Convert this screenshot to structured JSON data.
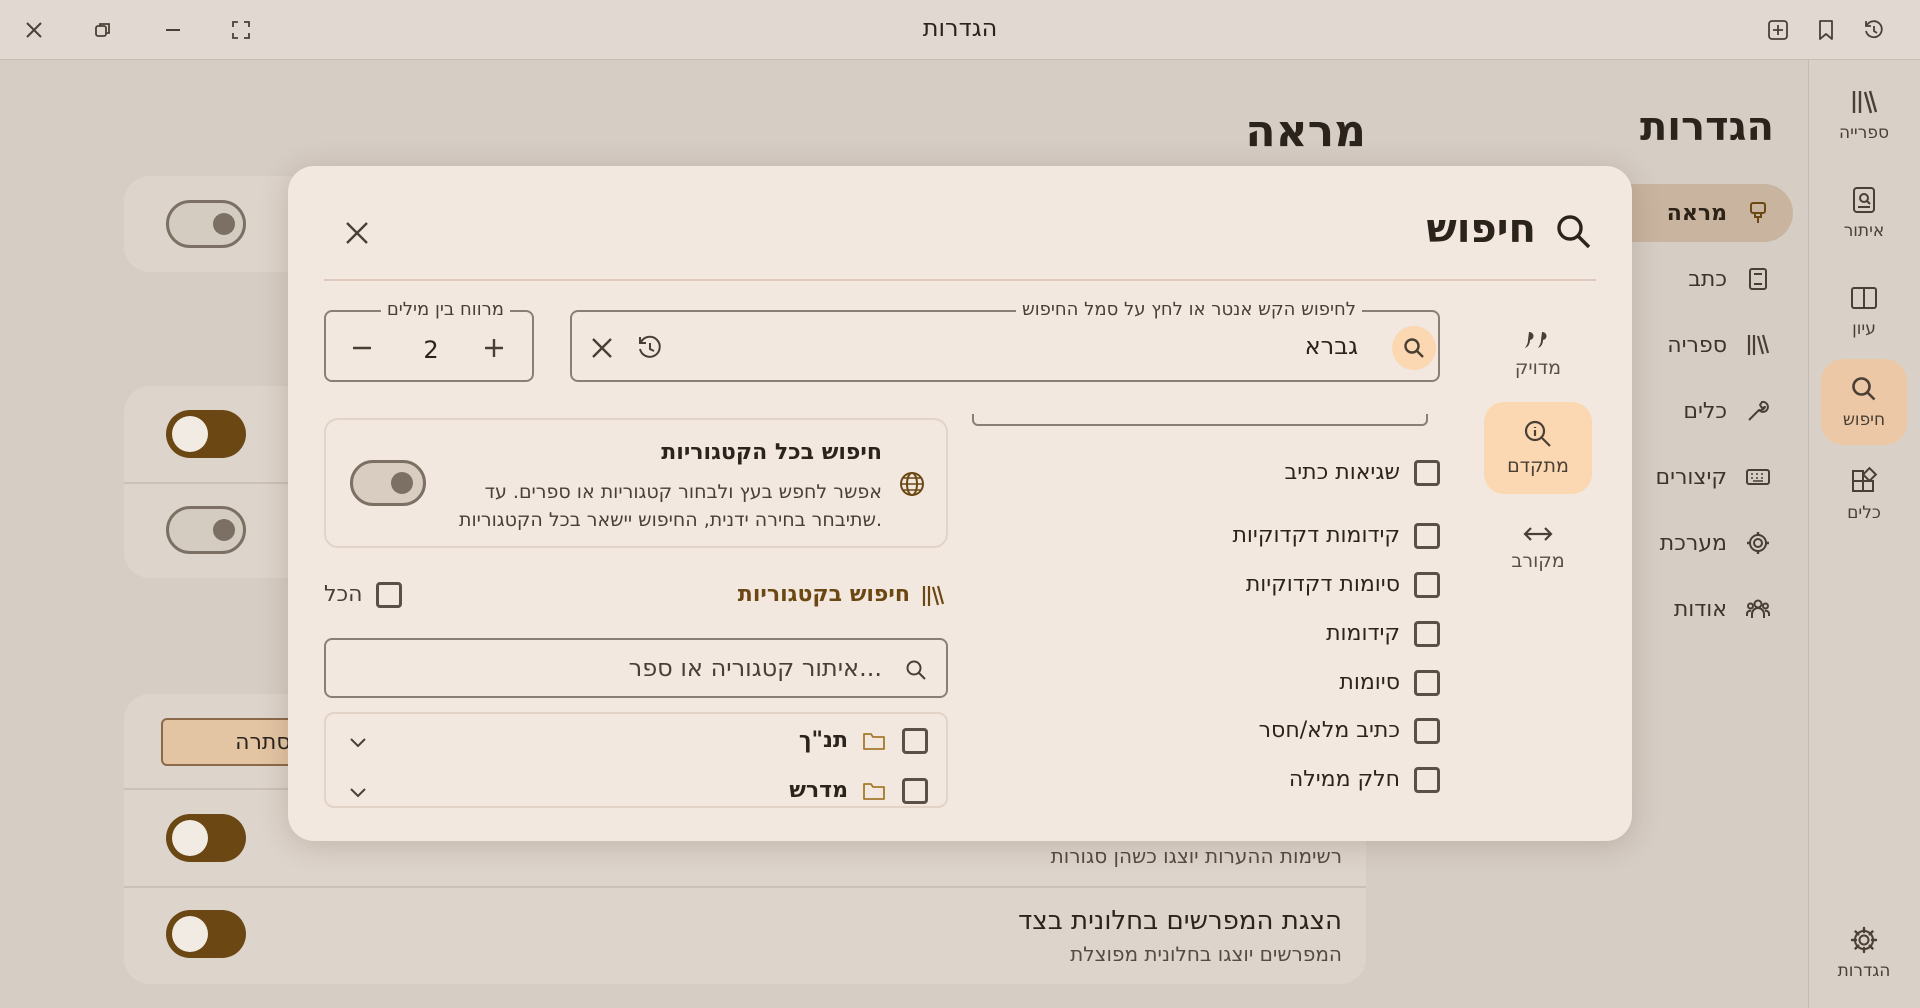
{
  "window": {
    "title": "הגדרות"
  },
  "rail": {
    "items": [
      {
        "label": "ספרייה",
        "icon": "library-icon"
      },
      {
        "label": "איתור",
        "icon": "find-book-icon"
      },
      {
        "label": "עיון",
        "icon": "book-open-icon"
      },
      {
        "label": "חיפוש",
        "icon": "search-icon"
      },
      {
        "label": "כלים",
        "icon": "tools-icon"
      }
    ],
    "settings_label": "הגדרות"
  },
  "settings": {
    "title": "הגדרות",
    "nav": [
      {
        "label": "מראה",
        "icon": "paint-brush-icon"
      },
      {
        "label": "כתב",
        "icon": "font-book-icon"
      },
      {
        "label": "ספריה",
        "icon": "library-icon"
      },
      {
        "label": "כלים",
        "icon": "wrench-icon"
      },
      {
        "label": "קיצורים",
        "icon": "keyboard-icon"
      },
      {
        "label": "מערכת",
        "icon": "gear-icon"
      },
      {
        "label": "אודות",
        "icon": "people-icon"
      }
    ]
  },
  "main": {
    "title": "מראה",
    "hide_button": "הסתרה",
    "rows": [
      {
        "sub": "רשימות ההערות יוצגו כשהן סגורות"
      },
      {
        "title": "הצגת המפרשים בחלונית בצד",
        "sub": "המפרשים יוצגו בחלונית מפוצלת"
      }
    ]
  },
  "dialog": {
    "title": "חיפוש",
    "modes": [
      {
        "label": "מדויק",
        "icon": "quote-icon"
      },
      {
        "label": "מתקדם",
        "icon": "advanced-search-icon"
      },
      {
        "label": "מקורב",
        "icon": "arrows-horizontal-icon"
      }
    ],
    "search": {
      "legend": "לחיפוש הקש אנטר או לחץ על סמל החיפוש",
      "value": "גברא"
    },
    "distance": {
      "legend": "מרווח בין מילים",
      "value": "2"
    },
    "options": [
      "שגיאות כתיב",
      "קידומות דקדוקיות",
      "סיומות דקדוקיות",
      "קידומות",
      "סיומות",
      "כתיב מלא/חסר",
      "חלק ממילה"
    ],
    "all_cats": {
      "title": "חיפוש בכל הקטגוריות",
      "desc": [
        "אפשר לחפש בעץ ולבחור קטגוריות או ספרים. עד",
        "שתיבחר בחירה ידנית, החיפוש יישאר בכל הקטגוריות."
      ]
    },
    "cats": {
      "title": "חיפוש בקטגוריות",
      "all_label": "הכל",
      "filter_placeholder": "איתור קטגוריה או ספר...",
      "tree": [
        "תנ\"ך",
        "מדרש"
      ]
    }
  }
}
